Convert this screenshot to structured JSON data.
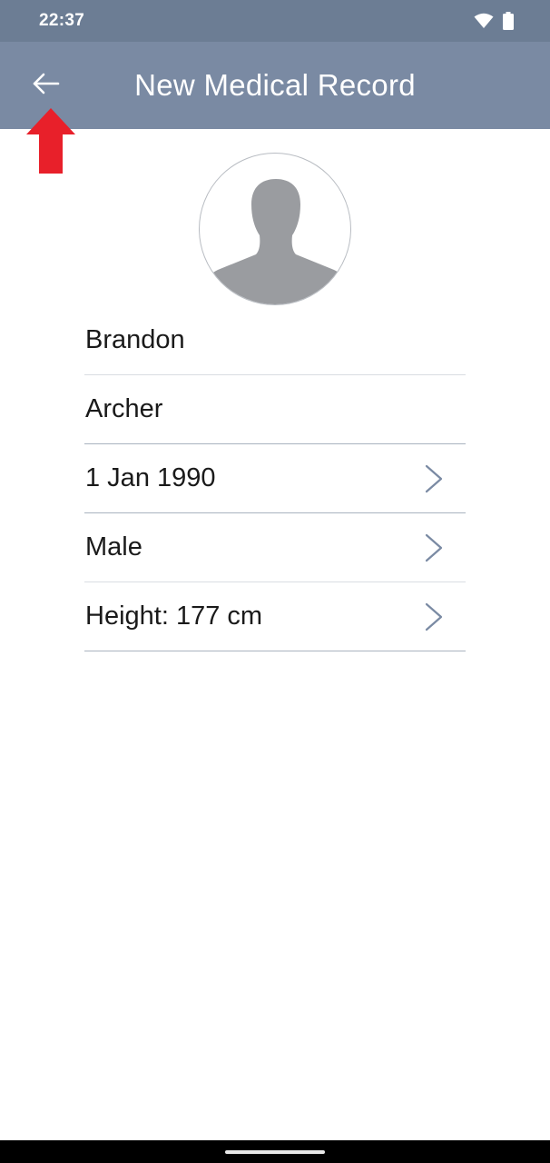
{
  "status_bar": {
    "time": "22:37",
    "icons": [
      "wifi-icon",
      "battery-icon"
    ]
  },
  "app_bar": {
    "title": "New Medical Record",
    "back_icon": "arrow-left-icon"
  },
  "annotation": {
    "icon": "red-up-arrow",
    "color": "#e8202a"
  },
  "avatar": {
    "icon": "person-silhouette-icon"
  },
  "form": {
    "first_name": "Brandon",
    "last_name": "Archer",
    "birth_date": "1 Jan 1990",
    "gender": "Male",
    "height": "Height: 177 cm"
  },
  "colors": {
    "status_bar": "#6c7d94",
    "app_bar": "#7a8aa3",
    "chevron": "#7a8aa3",
    "avatar_fill": "#9a9ca0"
  }
}
